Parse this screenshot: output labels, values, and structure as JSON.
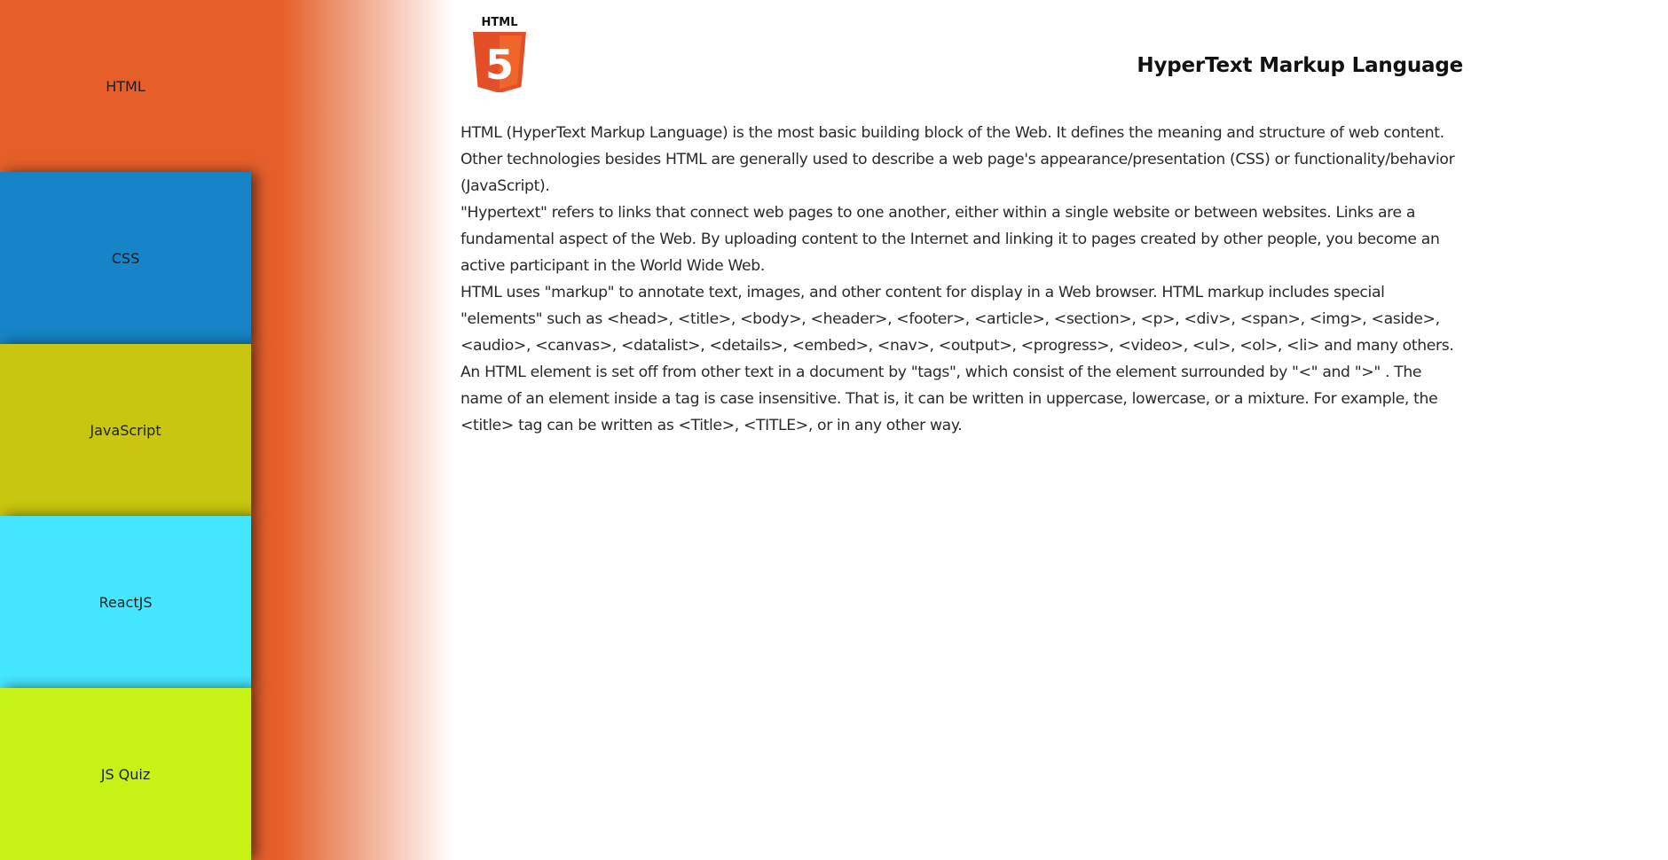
{
  "colors": {
    "html_orange": "#e65f2b",
    "css_blue": "#1684c6",
    "js_olive": "#c8c60e",
    "react_cyan": "#45e6ff",
    "quiz_lime": "#c6f215"
  },
  "sidebar": {
    "items": [
      {
        "label": "HTML",
        "color": "#e65f2b",
        "active": true
      },
      {
        "label": "CSS",
        "color": "#1684c6",
        "active": false
      },
      {
        "label": "JavaScript",
        "color": "#c8c60e",
        "active": false
      },
      {
        "label": "ReactJS",
        "color": "#45e6ff",
        "active": false
      },
      {
        "label": "JS Quiz",
        "color": "#c6f215",
        "active": false
      }
    ]
  },
  "logo": {
    "icon": "html5-logo-icon",
    "text": "HTML",
    "number": "5"
  },
  "main": {
    "title": "HyperText Markup Language",
    "paragraphs": [
      "HTML (HyperText Markup Language) is the most basic building block of the Web. It defines the meaning and structure of web content. Other technologies besides HTML are generally used to describe a web page's appearance/presentation (CSS) or functionality/behavior (JavaScript).",
      "\"Hypertext\" refers to links that connect web pages to one another, either within a single website or between websites. Links are a fundamental aspect of the Web. By uploading content to the Internet and linking it to pages created by other people, you become an active participant in the World Wide Web.",
      "HTML uses \"markup\" to annotate text, images, and other content for display in a Web browser. HTML markup includes special \"elements\" such as <head>, <title>, <body>, <header>, <footer>, <article>, <section>, <p>, <div>, <span>, <img>, <aside>, <audio>, <canvas>, <datalist>, <details>, <embed>, <nav>, <output>, <progress>, <video>, <ul>, <ol>, <li> and many others.",
      "An HTML element is set off from other text in a document by \"tags\", which consist of the element surrounded by \"<\" and \">\" . The name of an element inside a tag is case insensitive. That is, it can be written in uppercase, lowercase, or a mixture. For example, the <title> tag can be written as <Title>, <TITLE>, or in any other way."
    ]
  }
}
